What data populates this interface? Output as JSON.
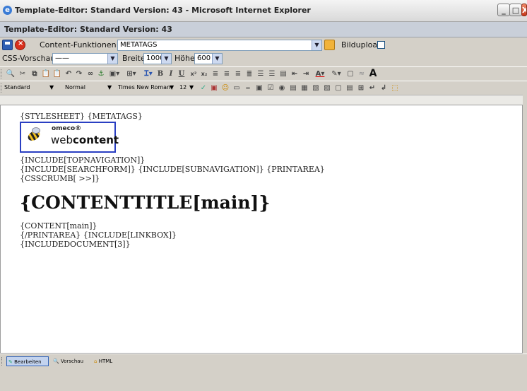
{
  "window": {
    "title": "Template-Editor: Standard Version: 43 - Microsoft Internet Explorer",
    "minimize": "_",
    "maximize": "□",
    "close": "X"
  },
  "header": {
    "title": "Template-Editor: Standard Version: 43"
  },
  "row1": {
    "label": "Content-Funktionen",
    "select_value": "METATAGS",
    "bildupload_label": "Bildupload"
  },
  "row2": {
    "css_label": "CSS-Vorschau",
    "css_value": "——",
    "breite_label": "Breite:",
    "breite_value": "1000",
    "hoehe_label": "Höhe:",
    "hoehe_value": "600"
  },
  "toolbar2": {
    "style": "Standard",
    "format": "Normal",
    "font": "Times New Roman",
    "size": "12"
  },
  "editor": {
    "line1": "{STYLESHEET} {METATAGS}",
    "logo_small": "omeco®",
    "logo_web": "web",
    "logo_content": "content",
    "line2": "{INCLUDE[TOPNAVIGATION]}",
    "line3": "{INCLUDE[SEARCHFORM]} {INCLUDE[SUBNAVIGATION]} {PRINTAREA}",
    "line4": "{CSSCRUMB[ >>]}",
    "content_title": "{CONTENTTITLE[main]}",
    "line5": "{CONTENT[main]}",
    "line6": "{/PRINTAREA} {INCLUDE[LINKBOX]}",
    "line7": "{INCLUDEDOCUMENT[3]}"
  },
  "bottom_tabs": {
    "edit": "Bearbeiten",
    "preview": "Vorschau",
    "html": "HTML"
  }
}
